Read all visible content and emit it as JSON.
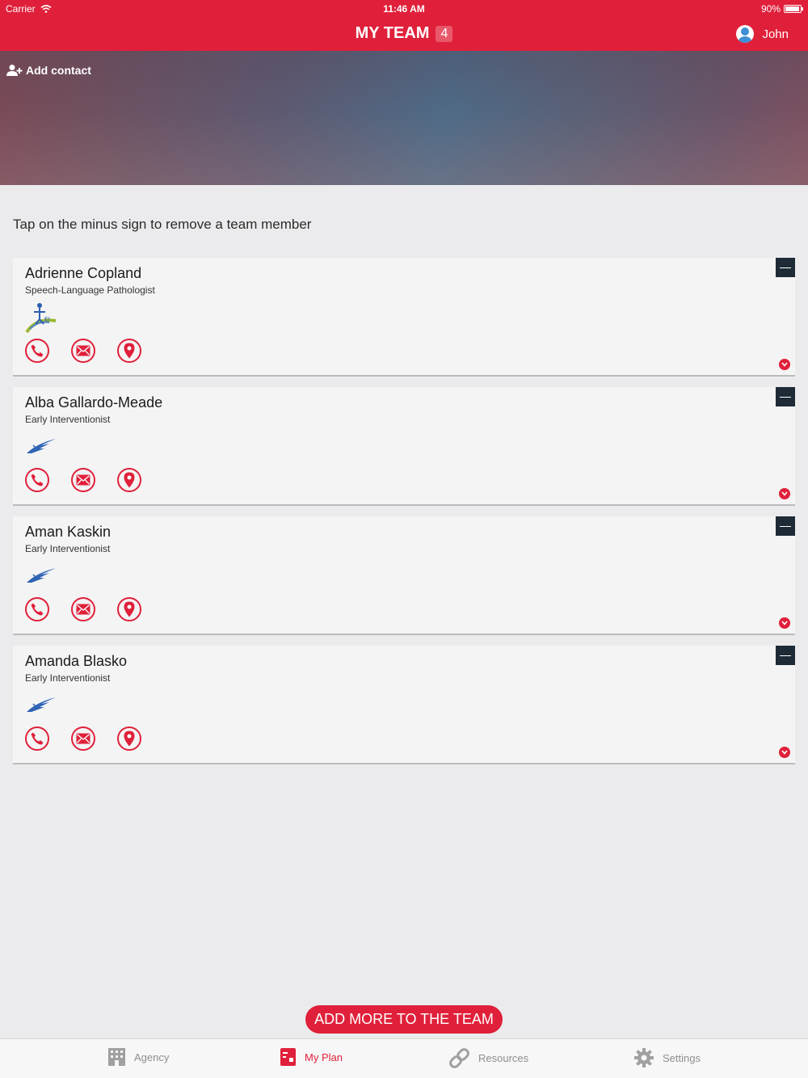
{
  "status_bar": {
    "carrier": "Carrier",
    "time": "11:46 AM",
    "battery": "90%"
  },
  "nav": {
    "title": "MY TEAM",
    "count": "4",
    "user_name": "John"
  },
  "hero": {
    "add_contact_label": "Add contact"
  },
  "instruction": "Tap on the minus sign to remove a team member",
  "team": [
    {
      "name": "Adrienne Copland",
      "role": "Speech-Language Pathologist",
      "logo": "agency-logo-slp"
    },
    {
      "name": "Alba Gallardo-Meade",
      "role": "Early Interventionist",
      "logo": "agency-logo-bird"
    },
    {
      "name": "Aman Kaskin",
      "role": "Early Interventionist",
      "logo": "agency-logo-bird"
    },
    {
      "name": "Amanda Blasko",
      "role": "Early Interventionist",
      "logo": "agency-logo-bird"
    }
  ],
  "add_more_label": "ADD MORE TO THE TEAM",
  "tabs": [
    {
      "label": "Agency",
      "icon": "building-icon"
    },
    {
      "label": "My Plan",
      "icon": "plan-icon",
      "active": true
    },
    {
      "label": "Resources",
      "icon": "link-icon"
    },
    {
      "label": "Settings",
      "icon": "gear-icon"
    }
  ],
  "colors": {
    "brand": "#e0203a",
    "minus_button": "#1e2a36"
  }
}
